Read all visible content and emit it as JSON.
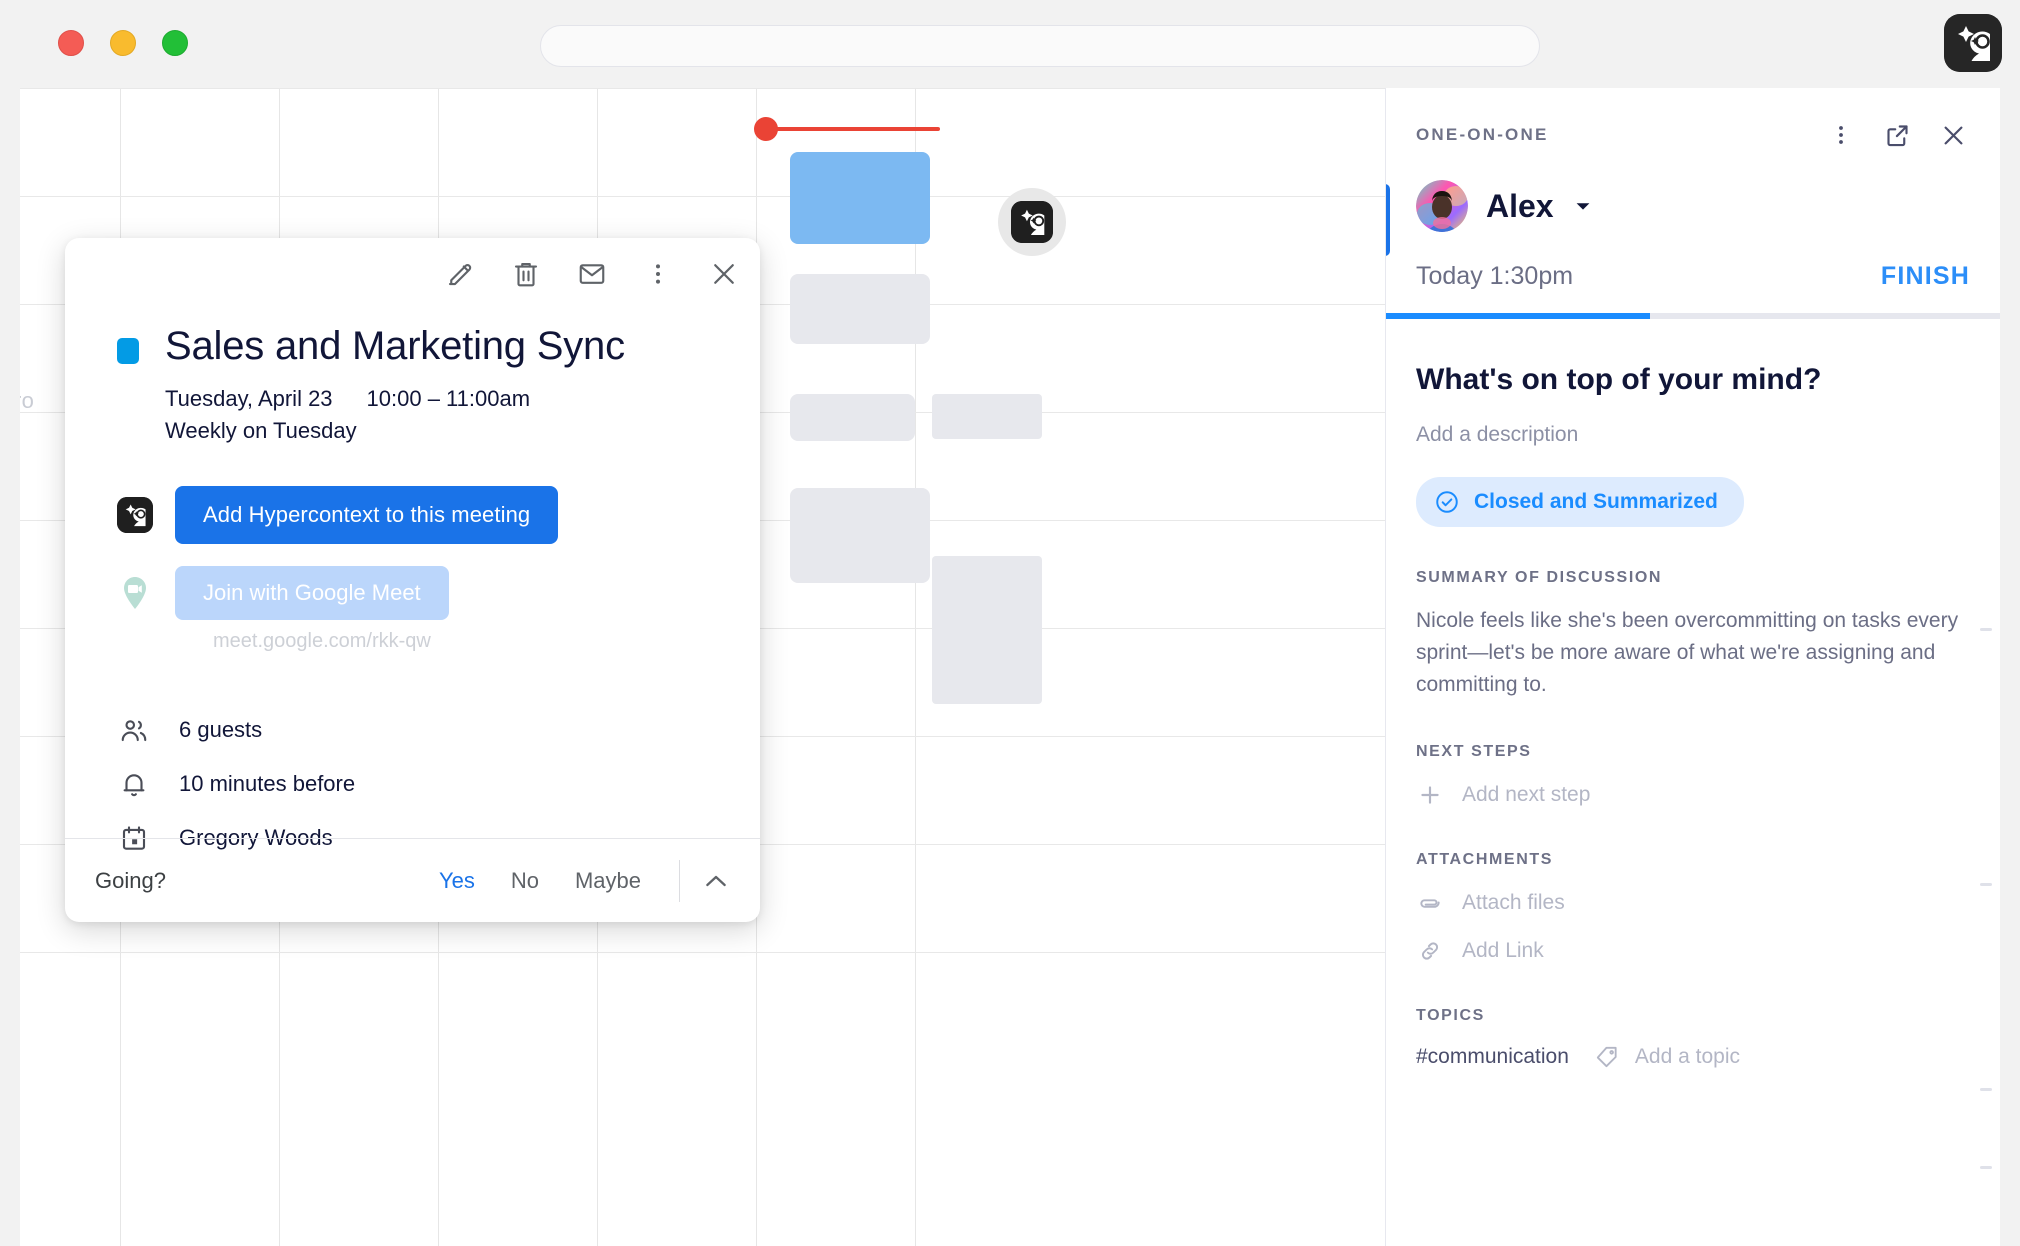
{
  "browser": {
    "traffic_lights": [
      "close",
      "minimize",
      "maximize"
    ],
    "url_value": "",
    "url_placeholder": "",
    "extension_icon": "hypercontext-logo-icon"
  },
  "calendar": {
    "ghost_label": "ro",
    "now_indicator_color": "#ea4335",
    "event_color": "#7cb9f2"
  },
  "popup": {
    "toolbar": {
      "edit_label": "edit-icon",
      "delete_label": "trash-icon",
      "email_label": "envelope-icon",
      "more_label": "more-vertical-icon",
      "close_label": "close-icon"
    },
    "color_chip": "#039be5",
    "title": "Sales and Marketing Sync",
    "date": "Tuesday, April 23",
    "time": "10:00 – 11:00am",
    "recurrence": "Weekly on Tuesday",
    "primary_button": "Add Hypercontext to this meeting",
    "meet_button": "Join with Google Meet",
    "meet_url": "meet.google.com/rkk-qw",
    "details": [
      {
        "icon": "people-icon",
        "text": "6 guests"
      },
      {
        "icon": "bell-icon",
        "text": "10 minutes before"
      },
      {
        "icon": "calendar-icon",
        "text": "Gregory Woods"
      }
    ],
    "footer": {
      "going_label": "Going?",
      "options": [
        "Yes",
        "No",
        "Maybe"
      ],
      "selected": "Yes",
      "caret": "chevron-up-icon"
    }
  },
  "sidebar": {
    "kicker": "ONE-ON-ONE",
    "actions": {
      "more": "more-vertical-icon",
      "open_external": "open-external-icon",
      "close": "close-icon"
    },
    "person_name": "Alex",
    "time": "Today 1:30pm",
    "finish_label": "FINISH",
    "progress_percent": 43,
    "question": "What's on top of your mind?",
    "add_description": "Add a description",
    "status_chip": "Closed and Summarized",
    "summary_label": "SUMMARY OF DISCUSSION",
    "summary_text": "Nicole feels like she's been overcommitting on tasks every sprint—let's be more aware of what we're assigning and committing to.",
    "next_steps_label": "NEXT STEPS",
    "add_next_step": "Add next step",
    "attachments_label": "ATTACHMENTS",
    "attach_files": "Attach files",
    "add_link": "Add Link",
    "topics_label": "TOPICS",
    "topic": "#communication",
    "add_topic": "Add a topic"
  }
}
